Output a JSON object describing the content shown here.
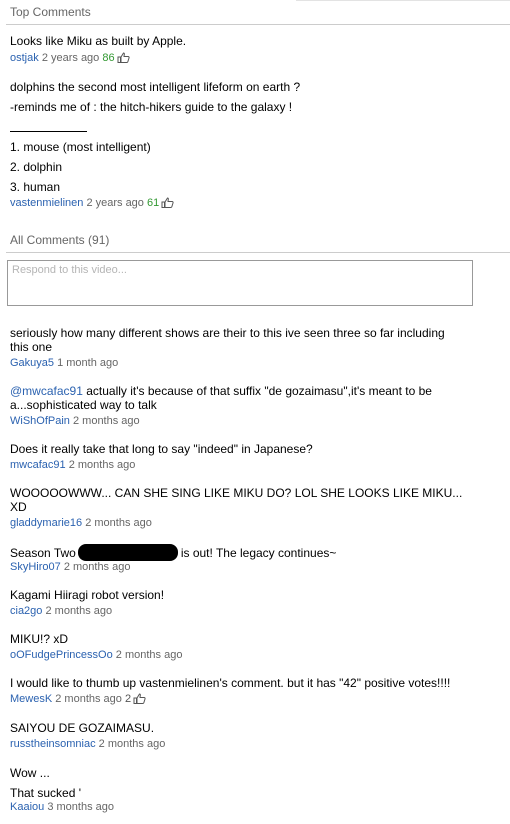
{
  "top_comments": {
    "title": "Top Comments",
    "items": [
      {
        "lines": [
          "Looks like Miku as built by Apple."
        ],
        "author": "ostjak",
        "time": "2 years ago",
        "votes": "86"
      },
      {
        "lines": [
          "dolphins the second most intelligent lifeform on earth ?",
          "-reminds me of : the hitch-hikers guide to the galaxy !",
          "1. mouse (most intelligent)",
          "2. dolphin",
          "3. human"
        ],
        "author": "vastenmielinen",
        "time": "2 years ago",
        "votes": "61"
      }
    ]
  },
  "all_comments": {
    "title": "All Comments (91)",
    "respond_placeholder": "Respond to this video...",
    "items": [
      {
        "text": "seriously how many different shows are their to this ive seen three so far including this one",
        "author": "Gakuya5",
        "time": "1 month ago"
      },
      {
        "mention": "@mwcafac91",
        "text": " actually it's because of that suffix \"de gozaimasu\",it's meant to be a...sophisticated way to talk",
        "author": "WiShOfPain",
        "time": "2 months ago"
      },
      {
        "text": "Does it really take that long to say \"indeed\" in Japanese?",
        "author": "mwcafac91",
        "time": "2 months ago"
      },
      {
        "text": "WOOOOOWWW... CAN SHE SING LIKE MIKU DO? LOL SHE LOOKS LIKE MIKU... XD",
        "author": "gladdymarie16",
        "time": "2 months ago"
      },
      {
        "text_before": "Season Two",
        "text_after": "is out! The legacy continues~",
        "author": "SkyHiro07",
        "time": "2 months ago"
      },
      {
        "text": "Kagami Hiiragi robot version!",
        "author": "cia2go",
        "time": "2 months ago"
      },
      {
        "text": "MIKU!? xD",
        "author": "oOFudgePrincessOo",
        "time": "2 months ago"
      },
      {
        "text": "I would like to thumb up vastenmielinen's comment. but it has \"42\" positive votes!!!!",
        "author": "MewesK",
        "time": "2 months ago",
        "votes": "2"
      },
      {
        "text": "SAIYOU DE GOZAIMASU.",
        "author": "russtheinsomniac",
        "time": "2 months ago"
      },
      {
        "lines": [
          "Wow ...",
          "That sucked '"
        ],
        "author": "Kaaiou",
        "time": "3 months ago"
      }
    ]
  },
  "colors": {
    "author": "#2b62b0",
    "votes": "#339933",
    "meta": "#666666",
    "rule": "#cccccc"
  },
  "icons": {
    "thumb": "thumbs-up-icon"
  }
}
